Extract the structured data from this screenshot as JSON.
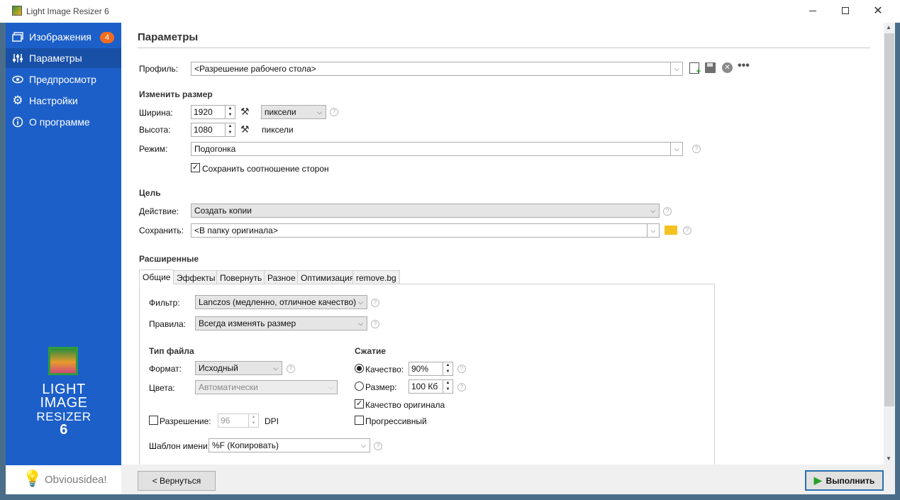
{
  "window": {
    "title": "Light Image Resizer 6"
  },
  "sidebar": {
    "items": [
      {
        "label": "Изображения",
        "badge": "4",
        "icon": "images-icon"
      },
      {
        "label": "Параметры",
        "icon": "sliders-icon"
      },
      {
        "label": "Предпросмотр",
        "icon": "eye-icon"
      },
      {
        "label": "Настройки",
        "icon": "gear-icon"
      },
      {
        "label": "О программе",
        "icon": "info-icon"
      }
    ],
    "logo": {
      "line1": "LIGHT",
      "line2": "IMAGE",
      "line3": "RESIZER",
      "line4": "6"
    },
    "brand": "Obviousidea!"
  },
  "page": {
    "title": "Параметры"
  },
  "profile": {
    "label": "Профиль:",
    "value": "<Разрешение рабочего стола>"
  },
  "resize": {
    "header": "Изменить размер",
    "width_label": "Ширина:",
    "width": "1920",
    "unit": "пиксели",
    "height_label": "Высота:",
    "height": "1080",
    "height_unit": "пиксели",
    "mode_label": "Режим:",
    "mode": "Подогонка",
    "keep_ratio": "Сохранить соотношение сторон"
  },
  "target": {
    "header": "Цель",
    "action_label": "Действие:",
    "action": "Создать копии",
    "save_label": "Сохранить:",
    "save": "<В папку оригинала>"
  },
  "advanced": {
    "header": "Расширенные",
    "tabs": [
      "Общие",
      "Эффекты",
      "Повернуть",
      "Разное",
      "Оптимизация",
      "remove.bg"
    ],
    "filter_label": "Фильтр:",
    "filter": "Lanczos  (медленно, отличное качество)",
    "rules_label": "Правила:",
    "rules": "Всегда изменять размер",
    "filetype_header": "Тип файла",
    "format_label": "Формат:",
    "format": "Исходный",
    "colors_label": "Цвета:",
    "colors": "Автоматически",
    "resolution_label": "Разрешение:",
    "resolution": "96",
    "dpi": "DPI",
    "name_template_label": "Шаблон имени:",
    "name_template": "%F (Копировать)",
    "compression_header": "Сжатие",
    "quality_label": "Качество:",
    "quality": "90%",
    "size_label": "Размер:",
    "size": "100 Кб",
    "original_quality": "Качество оригинала",
    "progressive": "Прогрессивный"
  },
  "buttons": {
    "back": "< Вернуться",
    "run": "Выполнить"
  },
  "help": "?",
  "colors": {
    "sidebar": "#1c5fc9",
    "accent": "#f26c1f",
    "run_border": "#2a6fb0"
  }
}
